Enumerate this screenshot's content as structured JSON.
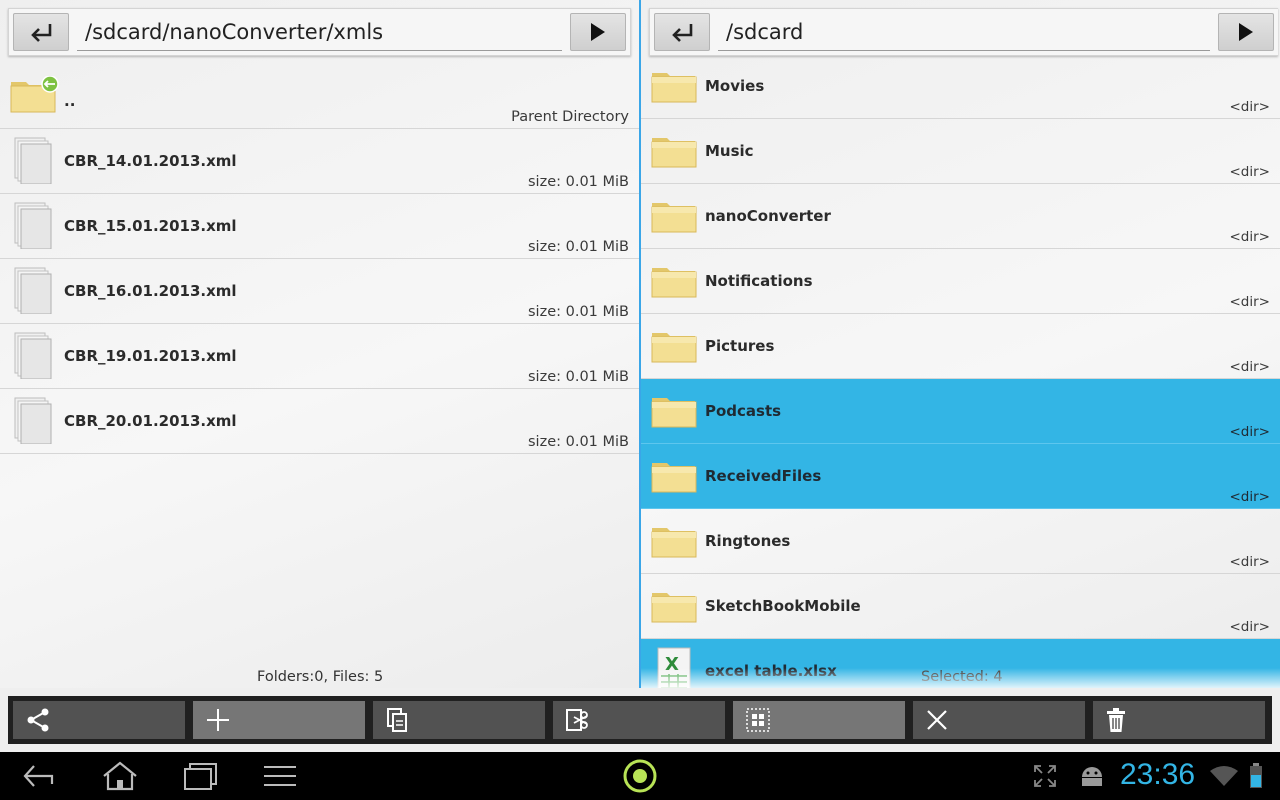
{
  "left_pane": {
    "path": "/sdcard/nanoConverter/xmls",
    "status": "Folders:0, Files: 5",
    "items": [
      {
        "name": "..",
        "meta": "Parent Directory",
        "type": "parent",
        "selected": false
      },
      {
        "name": "CBR_14.01.2013.xml",
        "meta": "size: 0.01 MiB",
        "type": "file",
        "selected": false
      },
      {
        "name": "CBR_15.01.2013.xml",
        "meta": "size: 0.01 MiB",
        "type": "file",
        "selected": false
      },
      {
        "name": "CBR_16.01.2013.xml",
        "meta": "size: 0.01 MiB",
        "type": "file",
        "selected": false
      },
      {
        "name": "CBR_19.01.2013.xml",
        "meta": "size: 0.01 MiB",
        "type": "file",
        "selected": false
      },
      {
        "name": "CBR_20.01.2013.xml",
        "meta": "size: 0.01 MiB",
        "type": "file",
        "selected": false
      }
    ]
  },
  "right_pane": {
    "path": "/sdcard",
    "status": "Selected: 4",
    "items": [
      {
        "name": "Movies",
        "meta": "<dir>",
        "type": "folder",
        "selected": false
      },
      {
        "name": "Music",
        "meta": "<dir>",
        "type": "folder",
        "selected": false
      },
      {
        "name": "nanoConverter",
        "meta": "<dir>",
        "type": "folder",
        "selected": false
      },
      {
        "name": "Notifications",
        "meta": "<dir>",
        "type": "folder",
        "selected": false
      },
      {
        "name": "Pictures",
        "meta": "<dir>",
        "type": "folder",
        "selected": false
      },
      {
        "name": "Podcasts",
        "meta": "<dir>",
        "type": "folder",
        "selected": true
      },
      {
        "name": "ReceivedFiles",
        "meta": "<dir>",
        "type": "folder",
        "selected": true
      },
      {
        "name": "Ringtones",
        "meta": "<dir>",
        "type": "folder",
        "selected": false
      },
      {
        "name": "SketchBookMobile",
        "meta": "<dir>",
        "type": "folder",
        "selected": false
      },
      {
        "name": "excel table.xlsx",
        "meta": "",
        "type": "excel",
        "selected": true
      }
    ]
  },
  "toolbar": {
    "buttons": [
      {
        "icon": "share-icon",
        "active": false
      },
      {
        "icon": "plus-icon",
        "active": true
      },
      {
        "icon": "copy-icon",
        "active": false
      },
      {
        "icon": "cut-icon",
        "active": false
      },
      {
        "icon": "select-all-icon",
        "active": true
      },
      {
        "icon": "close-icon",
        "active": false
      },
      {
        "icon": "delete-icon",
        "active": false
      }
    ]
  },
  "system_bar": {
    "clock": "23:36",
    "accent_color": "#33b5e5",
    "selection_color": "#33b5e5"
  }
}
